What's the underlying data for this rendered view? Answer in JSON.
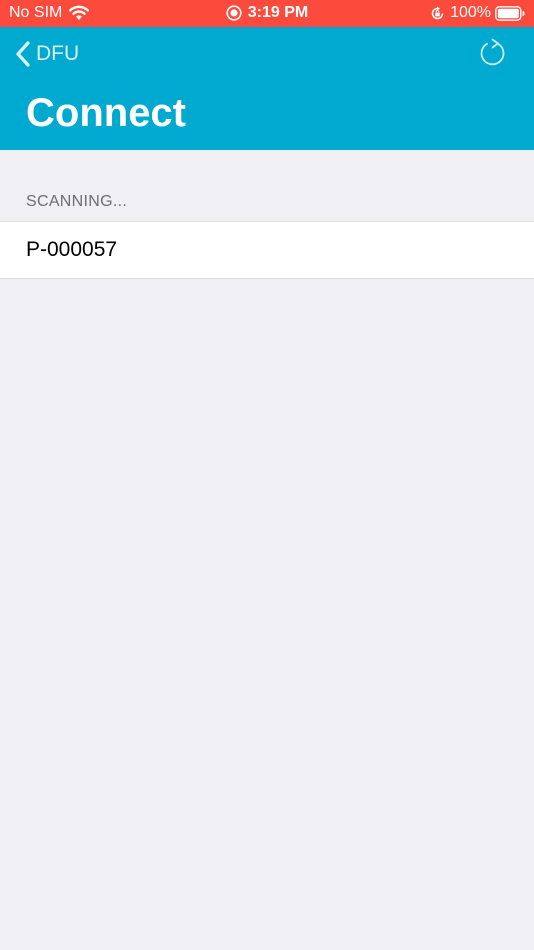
{
  "status_bar": {
    "carrier": "No SIM",
    "time": "3:19 PM",
    "battery": "100%",
    "icons": [
      "wifi-icon",
      "screen-record-icon",
      "orientation-lock-icon",
      "battery-icon"
    ]
  },
  "navbar": {
    "back_label": "DFU",
    "title": "Connect",
    "refresh_icon": "refresh-icon"
  },
  "section": {
    "header": "SCANNING..."
  },
  "devices": [
    {
      "name": "P-000057"
    }
  ],
  "colors": {
    "status_bar": "#fc4a3c",
    "navbar": "#00a9d0",
    "background": "#efeff4"
  }
}
